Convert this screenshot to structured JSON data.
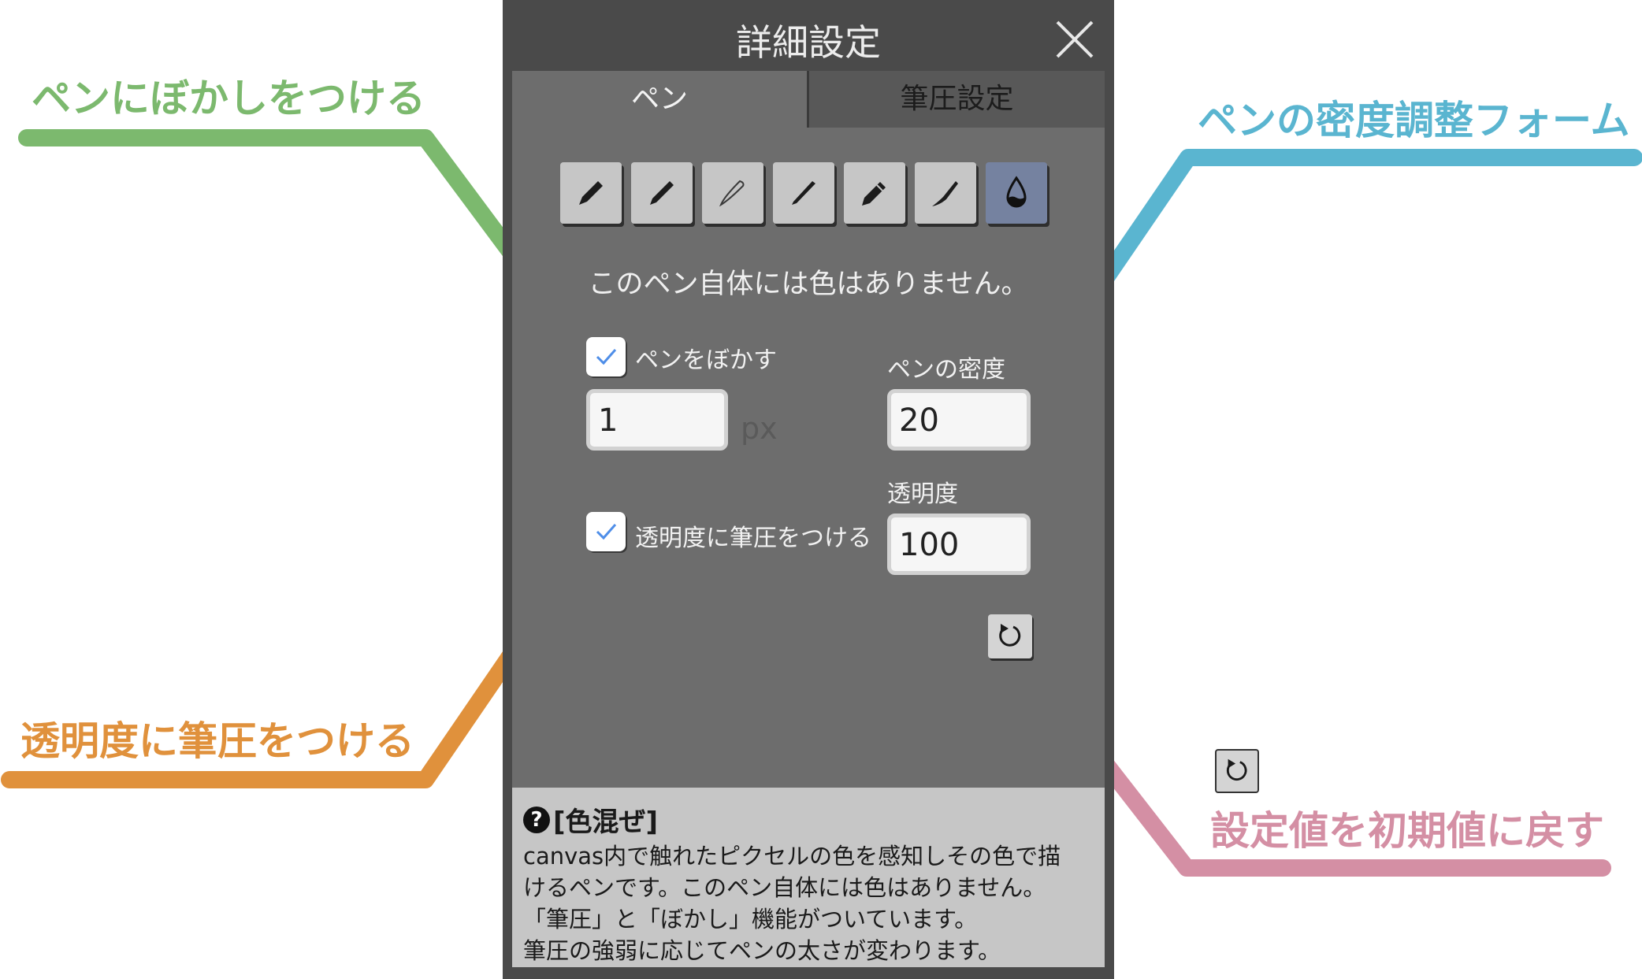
{
  "dialog": {
    "title": "詳細設定",
    "tabs": [
      {
        "label": "ペン",
        "active": true
      },
      {
        "label": "筆圧設定",
        "active": false
      }
    ],
    "pen_tools": [
      {
        "icon": "marker-pen-icon"
      },
      {
        "icon": "marker-pen-icon"
      },
      {
        "icon": "outline-brush-icon"
      },
      {
        "icon": "fine-brush-icon"
      },
      {
        "icon": "pencil-icon"
      },
      {
        "icon": "calligraphy-brush-icon"
      },
      {
        "icon": "water-drop-icon",
        "selected": true
      }
    ],
    "notice": "このペン自体には色はありません。",
    "blur": {
      "label": "ペンをぼかす",
      "checked": true,
      "value": "1",
      "unit": "px"
    },
    "density": {
      "label": "ペンの密度",
      "value": "20"
    },
    "opacity_pressure": {
      "label": "透明度に筆圧をつける",
      "checked": true
    },
    "opacity": {
      "label": "透明度",
      "value": "100"
    },
    "help": {
      "title": "[色混ぜ]",
      "lines": [
        "canvas内で触れたピクセルの色を感知しその色で描",
        "けるペンです。このペン自体には色はありません。",
        "「筆圧」と「ぼかし」機能がついています。",
        "筆圧の強弱に応じてペンの太さが変わります。"
      ]
    }
  },
  "annotations": {
    "blur": {
      "text": "ペンにぼかしをつける",
      "color": "#7cb96e"
    },
    "density": {
      "text": "ペンの密度調整フォーム",
      "color": "#5ab5d0"
    },
    "opacity_pressure": {
      "text": "透明度に筆圧をつける",
      "color": "#e0913c"
    },
    "reset": {
      "text": "設定値を初期値に戻す",
      "color": "#d48fa4"
    }
  },
  "colors": {
    "panel_bg": "#4a4a4a",
    "content_bg": "#6d6d6d",
    "selected_tool": "#7582a0",
    "help_bg": "#c6c6c6"
  }
}
